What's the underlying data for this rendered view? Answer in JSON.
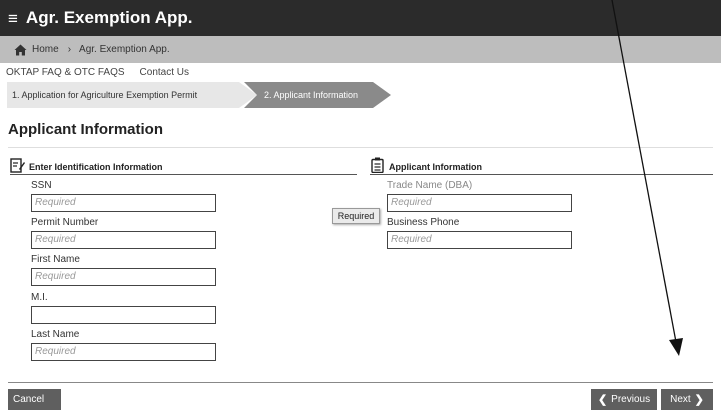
{
  "app": {
    "menu_icon": "hamburger-menu-icon",
    "title": "Agr. Exemption App."
  },
  "breadcrumb": {
    "home": "Home",
    "current": "Agr. Exemption App.",
    "separator": "›"
  },
  "links": [
    "OKTAP FAQ & OTC FAQS",
    "Contact Us"
  ],
  "wizard": {
    "step1": "1. Application for Agriculture Exemption Permit",
    "step2": "2. Applicant Information"
  },
  "page": {
    "title": "Applicant Information"
  },
  "left_section": {
    "title": "Enter Identification Information",
    "fields": [
      {
        "label": "SSN",
        "placeholder": "Required"
      },
      {
        "label": "Permit Number",
        "placeholder": "Required"
      },
      {
        "label": "First Name",
        "placeholder": "Required"
      },
      {
        "label": "M.I.",
        "placeholder": ""
      },
      {
        "label": "Last Name",
        "placeholder": "Required"
      }
    ]
  },
  "right_section": {
    "title": "Applicant Information",
    "fields": [
      {
        "label": "Trade Name (DBA)",
        "placeholder": "Required"
      },
      {
        "label": "Business Phone",
        "placeholder": "Required"
      }
    ]
  },
  "tooltip": "Required",
  "buttons": {
    "cancel": "Cancel",
    "previous": "Previous",
    "next": "Next"
  }
}
